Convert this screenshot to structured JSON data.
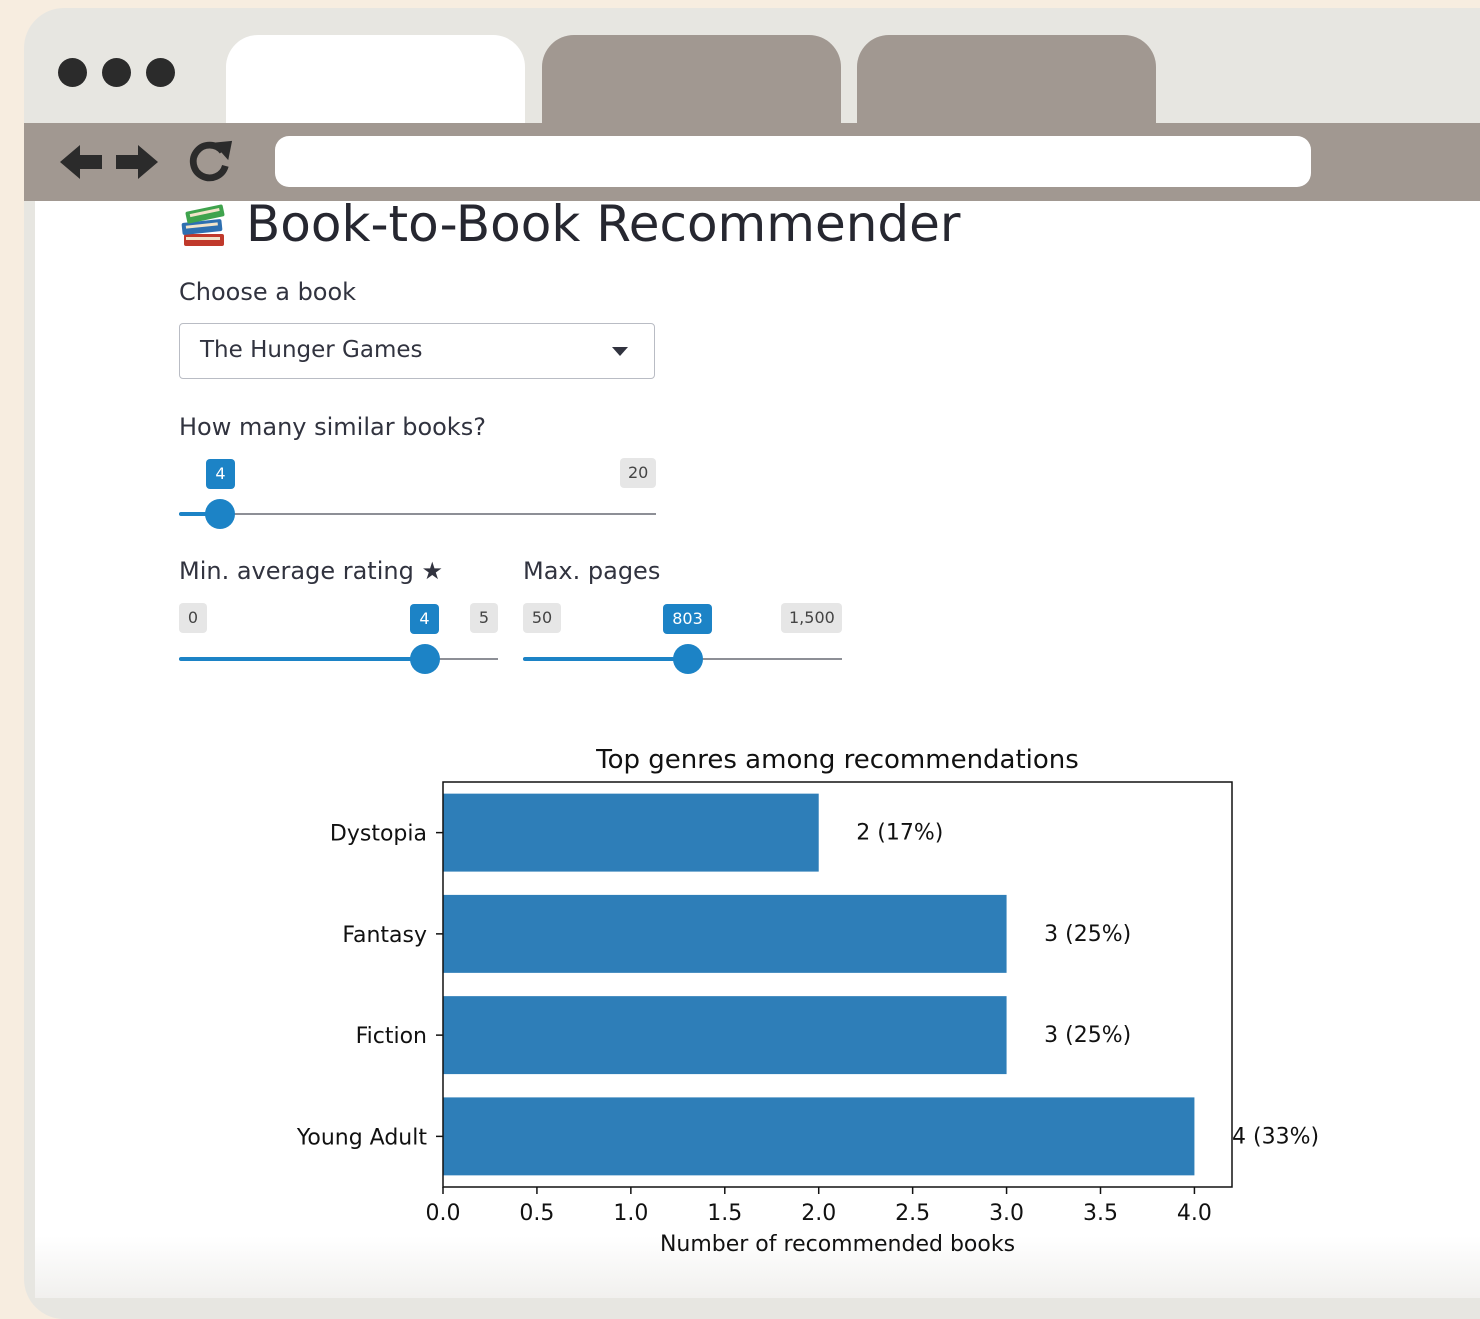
{
  "app": {
    "title": "Book-to-Book Recommender",
    "icon": "books-icon"
  },
  "book_select": {
    "label": "Choose a book",
    "value": "The Hunger Games"
  },
  "similar_slider": {
    "label": "How many similar books?",
    "value": "4",
    "max_label": "20",
    "fraction": 0.09
  },
  "rating_slider": {
    "label": "Min. average rating ★",
    "min_label": "0",
    "value": "4",
    "max_label": "5",
    "fraction": 0.8
  },
  "pages_slider": {
    "label": "Max. pages",
    "min_label": "50",
    "value": "803",
    "max_label": "1,500",
    "fraction": 0.52
  },
  "colors": {
    "accent": "#1c83c6",
    "bar": "#2e7eb8"
  },
  "chart_data": {
    "type": "bar",
    "orientation": "horizontal",
    "title": "Top genres among recommendations",
    "xlabel": "Number of recommended books",
    "ylabel": "",
    "categories": [
      "Dystopia",
      "Fantasy",
      "Fiction",
      "Young Adult"
    ],
    "values": [
      2,
      3,
      3,
      4
    ],
    "value_labels": [
      "2  (17%)",
      "3  (25%)",
      "3  (25%)",
      "4  (33%)"
    ],
    "xlim": [
      0,
      4.2
    ],
    "xticks": [
      "0.0",
      "0.5",
      "1.0",
      "1.5",
      "2.0",
      "2.5",
      "3.0",
      "3.5",
      "4.0"
    ],
    "grid": false
  }
}
